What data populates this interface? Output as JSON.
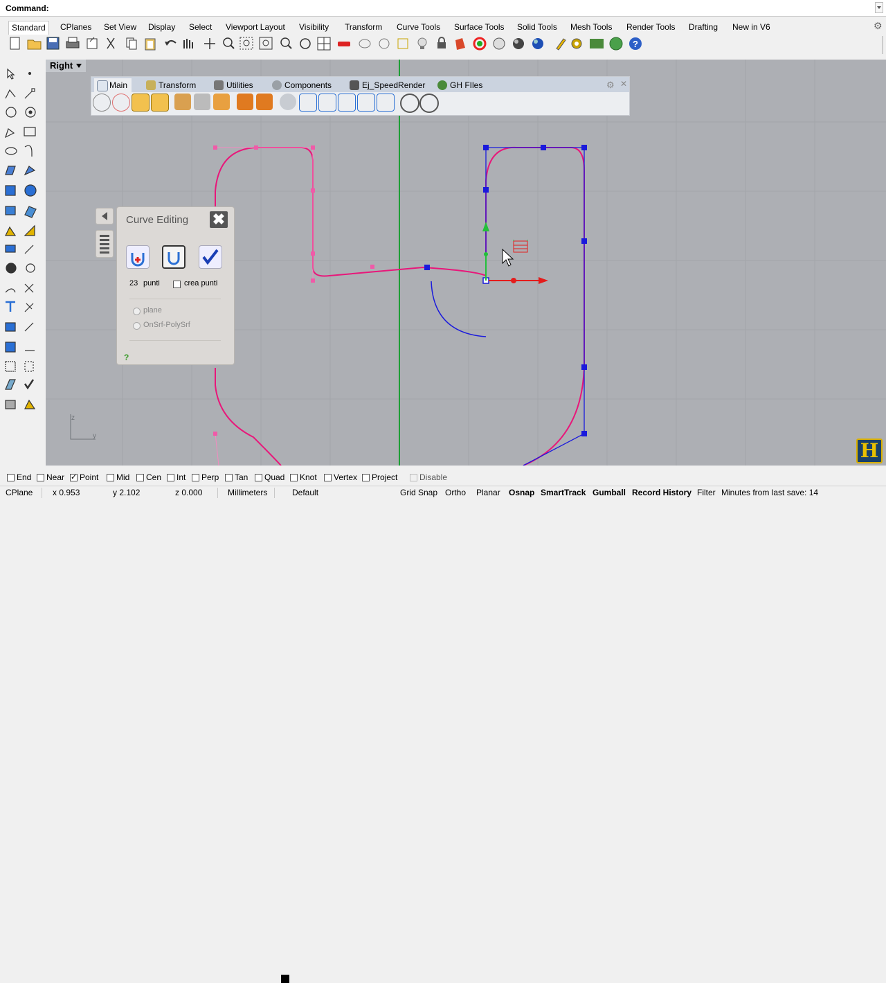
{
  "command": {
    "label": "Command:"
  },
  "tabs": [
    {
      "label": "Standard",
      "active": true
    },
    {
      "label": "CPlanes"
    },
    {
      "label": "Set View"
    },
    {
      "label": "Display"
    },
    {
      "label": "Select"
    },
    {
      "label": "Viewport Layout"
    },
    {
      "label": "Visibility"
    },
    {
      "label": "Transform"
    },
    {
      "label": "Curve Tools"
    },
    {
      "label": "Surface Tools"
    },
    {
      "label": "Solid Tools"
    },
    {
      "label": "Mesh Tools"
    },
    {
      "label": "Render Tools"
    },
    {
      "label": "Drafting"
    },
    {
      "label": "New in V6"
    }
  ],
  "viewport": {
    "title": "Right",
    "axis_z": "z",
    "axis_y": "y"
  },
  "panel": {
    "tabs": [
      {
        "label": "Main",
        "active": true
      },
      {
        "label": "Transform"
      },
      {
        "label": "Utilities"
      },
      {
        "label": "Components"
      },
      {
        "label": "Ej_SpeedRender"
      },
      {
        "label": "GH FIles"
      }
    ]
  },
  "curve_editing": {
    "title": "Curve Editing",
    "points_count": "23",
    "points_label": "punti",
    "create_points_label": "crea punti",
    "create_points_checked": false,
    "radio_plane": "plane",
    "radio_onsrf": "OnSrf-PolySrf",
    "help": "?"
  },
  "osnaps": [
    {
      "label": "End",
      "checked": false
    },
    {
      "label": "Near",
      "checked": false
    },
    {
      "label": "Point",
      "checked": true
    },
    {
      "label": "Mid",
      "checked": false
    },
    {
      "label": "Cen",
      "checked": false
    },
    {
      "label": "Int",
      "checked": false
    },
    {
      "label": "Perp",
      "checked": false
    },
    {
      "label": "Tan",
      "checked": false
    },
    {
      "label": "Quad",
      "checked": false
    },
    {
      "label": "Knot",
      "checked": false
    },
    {
      "label": "Vertex",
      "checked": false
    },
    {
      "label": "Project",
      "checked": false
    },
    {
      "label": "Disable",
      "checked": false
    }
  ],
  "status": {
    "cplane": "CPlane",
    "x": "x 0.953",
    "y": "y 2.102",
    "z": "z 0.000",
    "units": "Millimeters",
    "layer": "Default",
    "layer_color": "#000000",
    "grid_snap": "Grid Snap",
    "ortho": "Ortho",
    "planar": "Planar",
    "osnap": "Osnap",
    "smarttrack": "SmartTrack",
    "gumball": "Gumball",
    "record_history": "Record History",
    "filter": "Filter",
    "save_msg": "Minutes from last save: 14"
  },
  "colors": {
    "curve_pink": "#e8177a",
    "curve_blue": "#1a1adc",
    "gumball_green": "#22c03a",
    "gumball_red": "#e41c1c",
    "axis_green": "#1e9e36"
  }
}
